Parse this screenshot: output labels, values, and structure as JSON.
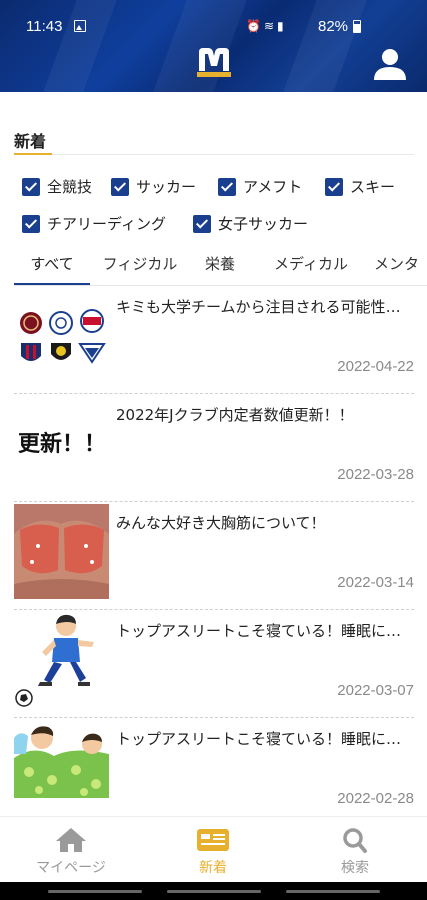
{
  "status_bar": {
    "time": "11:43",
    "battery": "82%",
    "icons": [
      "gallery-icon",
      "alarm-icon",
      "wifi-icon",
      "volte-icon",
      "signal-icon",
      "battery-icon"
    ]
  },
  "header": {
    "logo_icon": "m-logo-icon",
    "user_icon": "user-icon"
  },
  "section": {
    "title": "新着"
  },
  "filters": [
    {
      "label": "全競技",
      "checked": true
    },
    {
      "label": "サッカー",
      "checked": true
    },
    {
      "label": "アメフト",
      "checked": true
    },
    {
      "label": "スキー",
      "checked": true
    },
    {
      "label": "チアリーディング",
      "checked": true
    },
    {
      "label": "女子サッカー",
      "checked": true
    }
  ],
  "tabs": [
    {
      "label": "すべて",
      "active": true
    },
    {
      "label": "フィジカル",
      "active": false
    },
    {
      "label": "栄養",
      "active": false
    },
    {
      "label": "メディカル",
      "active": false
    },
    {
      "label": "メンタ",
      "active": false
    }
  ],
  "articles": [
    {
      "title": "キミも大学チームから注目される可能性がある！",
      "date": "2022-04-22",
      "thumb": "team-logos"
    },
    {
      "title": "2022年Jクラブ内定者数値更新！！",
      "date": "2022-03-28",
      "thumb": "update-text",
      "thumb_text": "更新！！"
    },
    {
      "title": "みんな大好き大胸筋について！",
      "date": "2022-03-14",
      "thumb": "chest-muscle"
    },
    {
      "title": "トップアスリートこそ寝ている！睡眠について",
      "date": "2022-03-07",
      "thumb": "soccer-runner"
    },
    {
      "title": "トップアスリートこそ寝ている！睡眠について",
      "date": "2022-02-28",
      "thumb": "sleeping-kids"
    }
  ],
  "bottom_nav": [
    {
      "label": "マイページ",
      "icon": "home-icon",
      "active": false
    },
    {
      "label": "新着",
      "icon": "news-icon",
      "active": true
    },
    {
      "label": "検索",
      "icon": "search-icon",
      "active": false
    }
  ],
  "colors": {
    "brand_navy": "#1b3f8f",
    "accent_gold": "#e7b02e",
    "inactive_gray": "#9a9a9a"
  }
}
